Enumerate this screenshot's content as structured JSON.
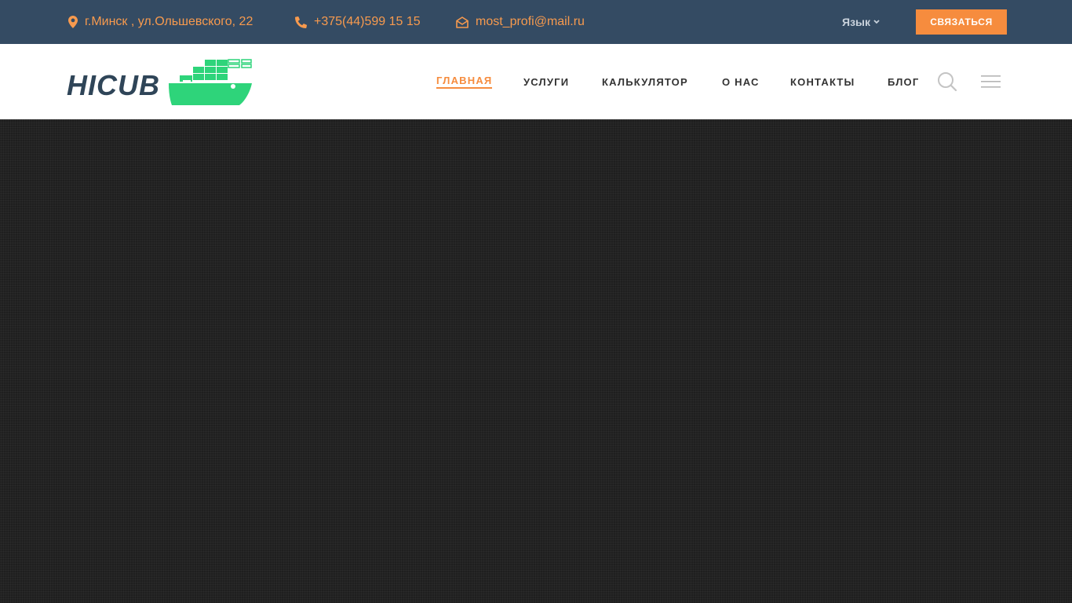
{
  "topbar": {
    "address": "г.Минск , ул.Ольшевского, 22",
    "phone": "+375(44)599 15 15",
    "email": "most_profi@mail.ru",
    "language_label": "Язык",
    "cta_label": "Связаться",
    "address_icon": "map-marker-icon",
    "phone_icon": "phone-icon",
    "email_icon": "envelope-icon"
  },
  "header": {
    "logo_text": "HICUB",
    "nav": {
      "home": "Главная",
      "services": "Услуги",
      "calculator": "Калькулятор",
      "about": "О нас",
      "contacts": "Контакты",
      "blog": "Блог"
    },
    "search_icon": "search-icon",
    "menu_icon": "hamburger-menu-icon"
  },
  "colors": {
    "topbar_bg": "#344b63",
    "accent": "#f68c3e",
    "logo_dark": "#2f4558",
    "logo_green": "#2ed47a",
    "hero_bg": "#1f1f1f"
  }
}
